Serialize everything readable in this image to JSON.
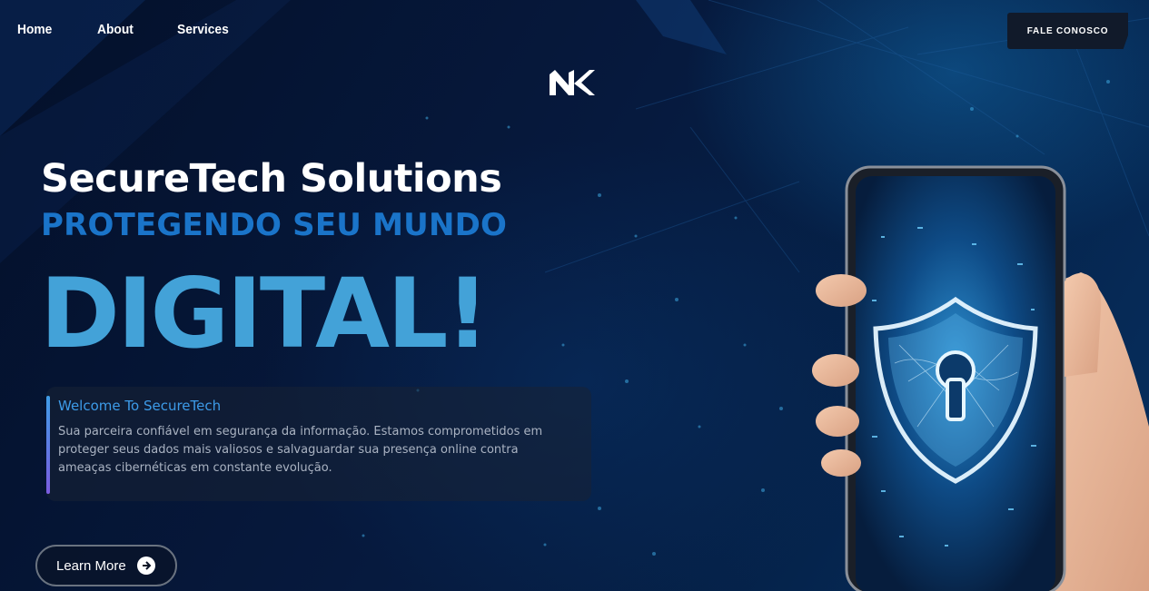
{
  "nav": {
    "home": "Home",
    "about": "About",
    "services": "Services"
  },
  "cta": {
    "label": "FALE CONOSCO"
  },
  "logo": {
    "icon": "nk-logo-icon"
  },
  "hero": {
    "title": "SecureTech Solutions",
    "subtitle": "PROTEGENDO SEU MUNDO",
    "big": "DIGITAL!"
  },
  "welcome": {
    "title": "Welcome To SecureTech",
    "text": "Sua parceira confiável em segurança da informação. Estamos comprometidos em proteger seus dados mais valiosos e salvaguardar sua presença online contra ameaças cibernéticas em constante evolução."
  },
  "learn_more": {
    "label": "Learn More",
    "icon": "arrow-right-circle-icon"
  },
  "colors": {
    "background": "#04122b",
    "subtitle": "#1a74c9",
    "big_text": "#43a2d8",
    "accent": "#3d9be8"
  }
}
